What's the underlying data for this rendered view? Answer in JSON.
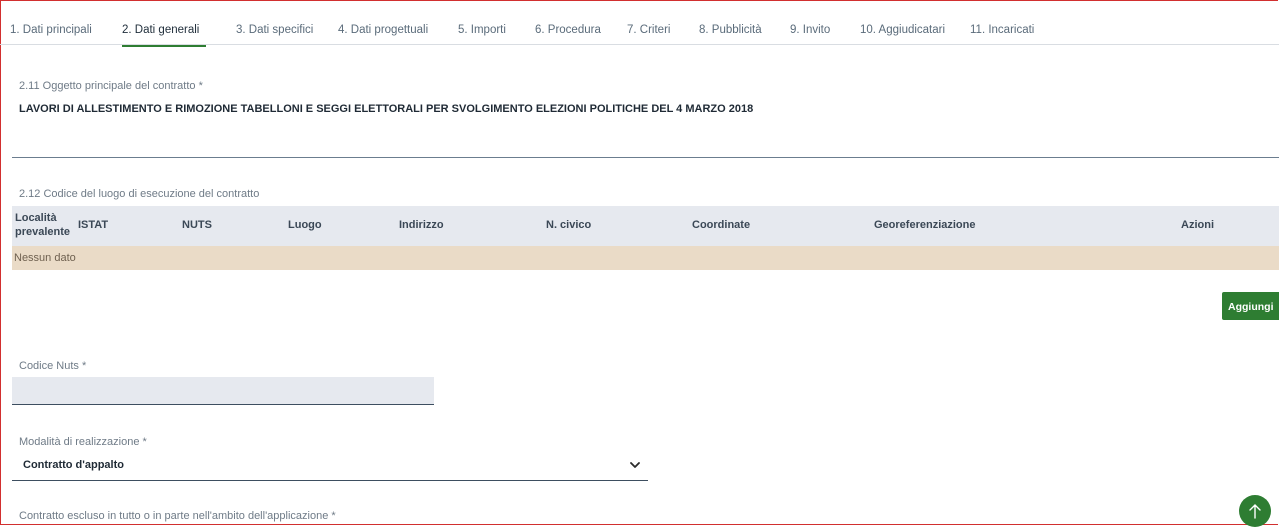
{
  "tabs": [
    {
      "label": "1. Dati principali",
      "active": false
    },
    {
      "label": "2. Dati generali",
      "active": true
    },
    {
      "label": "3. Dati specifici",
      "active": false
    },
    {
      "label": "4. Dati progettuali",
      "active": false
    },
    {
      "label": "5. Importi",
      "active": false
    },
    {
      "label": "6. Procedura",
      "active": false
    },
    {
      "label": "7. Criteri",
      "active": false
    },
    {
      "label": "8. Pubblicità",
      "active": false
    },
    {
      "label": "9. Invito",
      "active": false
    },
    {
      "label": "10. Aggiudicatari",
      "active": false
    },
    {
      "label": "11. Incaricati",
      "active": false
    }
  ],
  "oggetto": {
    "label": "2.11 Oggetto principale del contratto *",
    "value": "LAVORI DI ALLESTIMENTO E RIMOZIONE TABELLONI E SEGGI ELETTORALI PER SVOLGIMENTO ELEZIONI POLITICHE DEL 4 MARZO 2018"
  },
  "luogo_table": {
    "label": "2.12 Codice del luogo di esecuzione del contratto",
    "columns": {
      "localita_1": "Località",
      "localita_2": "prevalente",
      "istat": "ISTAT",
      "nuts": "NUTS",
      "luogo": "Luogo",
      "indirizzo": "Indirizzo",
      "civico": "N. civico",
      "coordinate": "Coordinate",
      "georef": "Georeferenziazione",
      "azioni": "Azioni"
    },
    "empty_text": "Nessun dato",
    "add_button": "Aggiungi"
  },
  "codice_nuts": {
    "label": "Codice Nuts *",
    "value": ""
  },
  "modalita": {
    "label": "Modalità di realizzazione *",
    "selected": "Contratto d'appalto"
  },
  "contratto_escluso": {
    "label": "Contratto escluso in tutto o in parte nell'ambito dell'applicazione *"
  },
  "colors": {
    "accent": "#2e7d32",
    "empty_row": "#eadbc7",
    "header_bg": "#e6e9ef",
    "frame": "#d22f2f"
  },
  "icons": {
    "select_chevron": "chevron-down-icon",
    "scroll_top": "arrow-up-icon"
  }
}
